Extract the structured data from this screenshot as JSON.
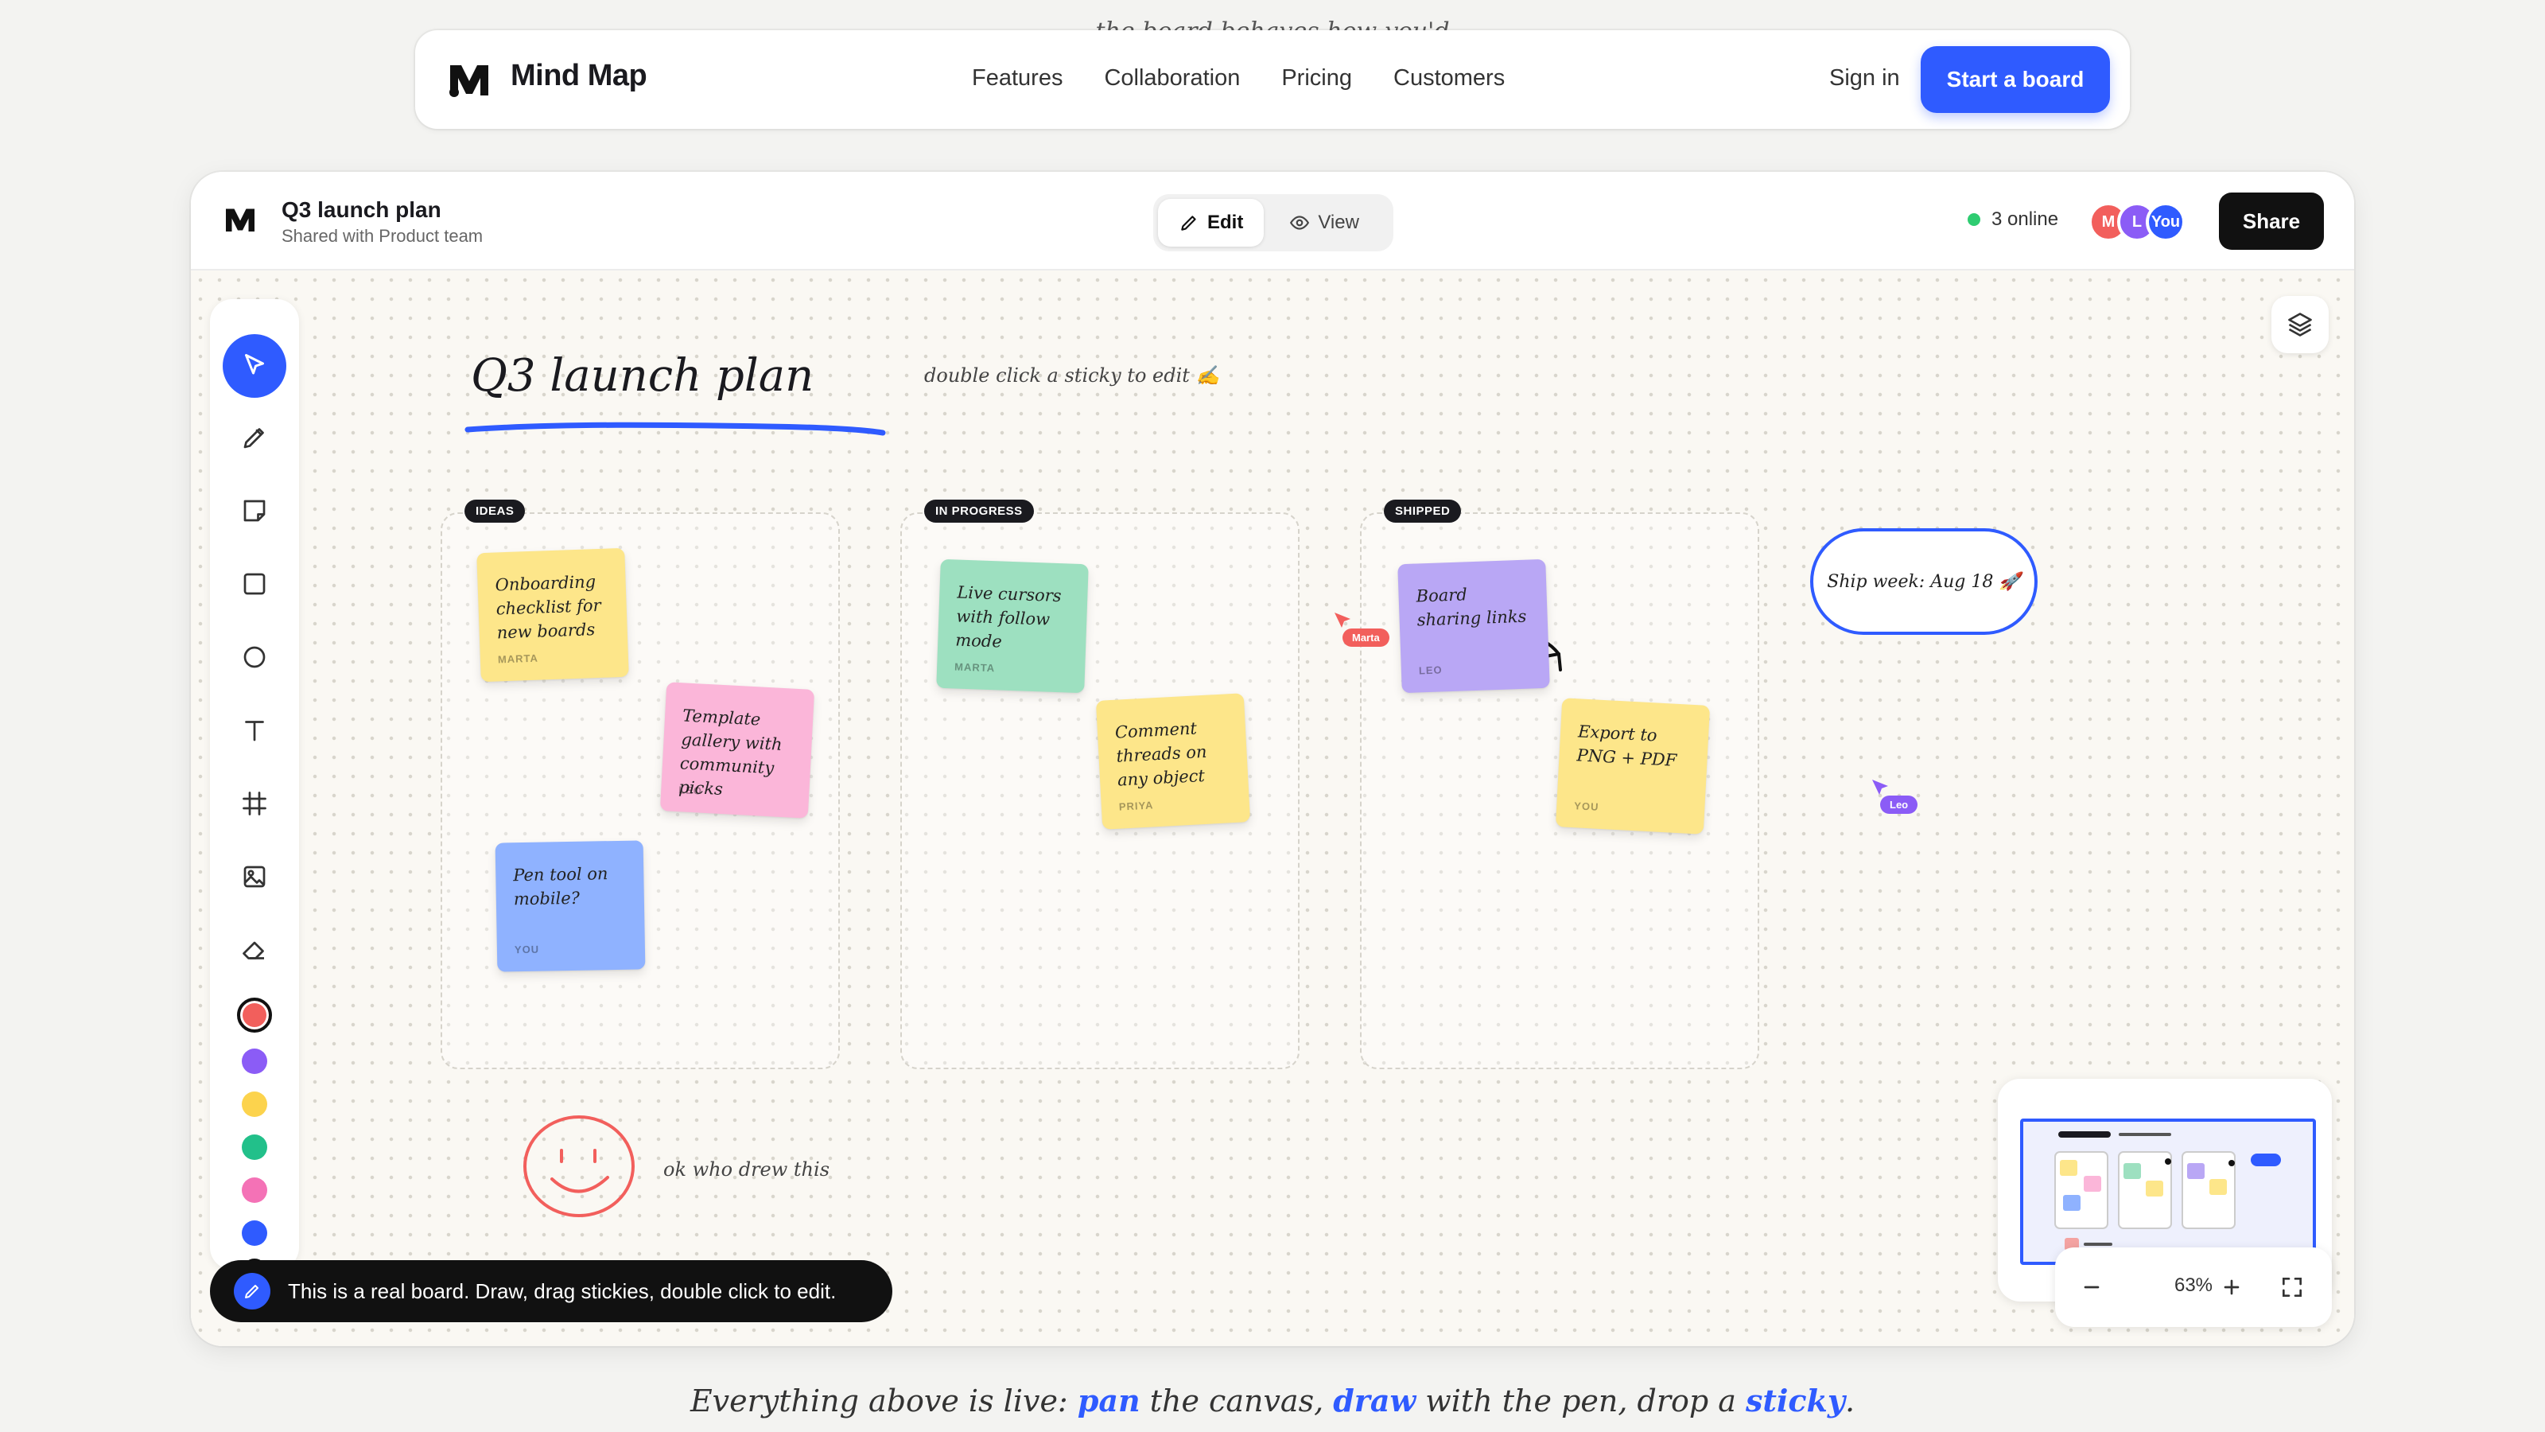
{
  "nav": {
    "brand": "Mind Map",
    "links": [
      "Features",
      "Collaboration",
      "Pricing",
      "Customers"
    ],
    "sign_in": "Sign in",
    "cta": "Start a board",
    "clipped_tagline": "the board behaves how you'd"
  },
  "doc": {
    "title": "Q3 launch plan",
    "subtitle": "Shared with Product team"
  },
  "mode": {
    "edit": "Edit",
    "view": "View",
    "active": "edit"
  },
  "presence": {
    "online": "3 online",
    "avatars": [
      {
        "initial": "M",
        "color": "#f25f5c"
      },
      {
        "initial": "L",
        "color": "#8b5cf6"
      },
      {
        "initial": "You",
        "color": "#2f5bff"
      }
    ]
  },
  "share_label": "Share",
  "tools": [
    "select-icon",
    "pen-icon",
    "sticky-icon",
    "rectangle-icon",
    "ellipse-icon",
    "text-icon",
    "frame-icon",
    "image-icon",
    "eraser-icon"
  ],
  "palette": [
    "#f25f5c",
    "#8b5cf6",
    "#fcd34d",
    "#22c08a",
    "#f472b6",
    "#2f5bff",
    "#111111"
  ],
  "selected_color": "#f25f5c",
  "board": {
    "title": "Q3 launch plan",
    "hint": "double click a sticky to edit ✍️",
    "columns": [
      {
        "tag": "IDEAS",
        "stickies": [
          {
            "text": "Onboarding checklist for new boards",
            "author": "MARTA",
            "color": "#fde68a"
          },
          {
            "text": "Template gallery with community picks",
            "author": "LEO",
            "color": "#fbb6d9"
          },
          {
            "text": "Pen tool on mobile?",
            "author": "YOU",
            "color": "#8fb2ff"
          }
        ]
      },
      {
        "tag": "IN PROGRESS",
        "stickies": [
          {
            "text": "Live cursors with follow mode",
            "author": "MARTA",
            "color": "#9de0c0"
          },
          {
            "text": "Comment threads on any object",
            "author": "PRIYA",
            "color": "#fde68a"
          }
        ]
      },
      {
        "tag": "SHIPPED",
        "stickies": [
          {
            "text": "Board sharing links",
            "author": "LEO",
            "color": "#b9a7f5"
          },
          {
            "text": "Export to PNG + PDF",
            "author": "YOU",
            "color": "#fde68a"
          }
        ]
      }
    ],
    "cursors": [
      {
        "name": "Marta",
        "color": "#f25f5c"
      },
      {
        "name": "Leo",
        "color": "#8b5cf6"
      }
    ],
    "pill_node": "Ship week: Aug 18 🚀",
    "smiley_note": "ok who drew this"
  },
  "zoom": "63%",
  "toast": "This is a real board. Draw, drag stickies, double click to edit.",
  "footer": {
    "prefix": "Everything above is live: ",
    "w1": "pan",
    "mid1": " the canvas, ",
    "w2": "draw",
    "mid2": " with the pen, drop a ",
    "w3": "sticky",
    "suffix": "."
  }
}
